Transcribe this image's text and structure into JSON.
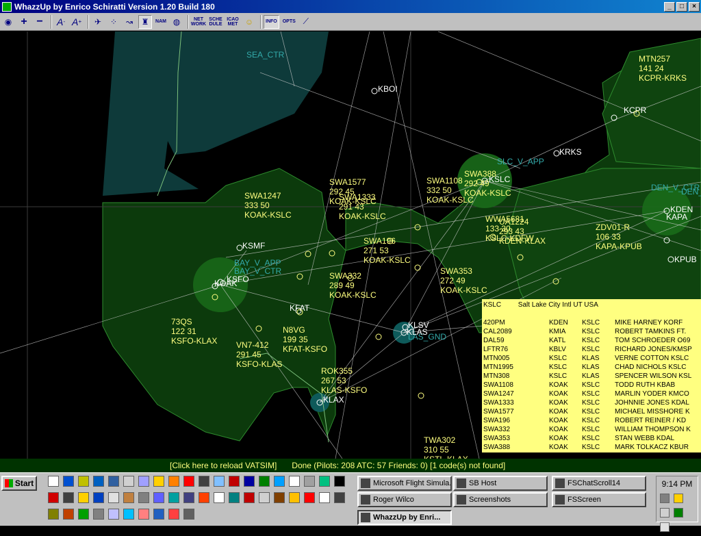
{
  "window": {
    "title": "WhazzUp by Enrico Schiratti Version 1.20 Build 180"
  },
  "toolbar": {
    "net_work": "NET WORK",
    "schedule": "SCHE DULE",
    "icao_met": "ICAO MET",
    "nam": "NAM",
    "info": "INFO",
    "opts": "OPTS"
  },
  "map": {
    "sector_labels": [
      {
        "text": "SEA_CTR"
      },
      {
        "text": "SLC_V_APP"
      },
      {
        "text": "DEN_V_CTR"
      },
      {
        "text": "DEN_"
      },
      {
        "text": "BAY_V_APP"
      },
      {
        "text": "BAY_V_CTR"
      },
      {
        "text": "LAS_GND"
      }
    ],
    "airports": [
      {
        "code": "KBOI"
      },
      {
        "code": "KCPR"
      },
      {
        "code": "KRKS"
      },
      {
        "code": "KSLC"
      },
      {
        "code": "KDEN"
      },
      {
        "code": "KAPA"
      },
      {
        "code": "KPUB"
      },
      {
        "code": "KSMF"
      },
      {
        "code": "KSFO"
      },
      {
        "code": "KOAK"
      },
      {
        "code": "KFAT"
      },
      {
        "code": "KLSV"
      },
      {
        "code": "KLAS"
      },
      {
        "code": "KLAX"
      }
    ],
    "flights": [
      {
        "callsign": "MTN257",
        "alt_spd": "141 24",
        "route": "KCPR-KRKS"
      },
      {
        "callsign": "SWA1247",
        "alt_spd": "333 50",
        "route": "KOAK-KSLC"
      },
      {
        "callsign": "SWA1577",
        "alt_spd": "292 45",
        "route": "KOAK-KSLC"
      },
      {
        "callsign": "SWA1333",
        "alt_spd": "291 43",
        "route": "KOAK-KSLC"
      },
      {
        "callsign": "SWA1108",
        "alt_spd": "332 50",
        "route": "KOAK-KSLC"
      },
      {
        "callsign": "SWA388",
        "alt_spd": "292 49",
        "route": "KOAK-KSLC"
      },
      {
        "callsign": "WWA5681",
        "alt_spd": "133 30",
        "route": "KSLC-KDFW"
      },
      {
        "callsign": "UA1224",
        "alt_spd": "293 43",
        "route": "KDEN-KLAX"
      },
      {
        "callsign": "ZDV01-R",
        "alt_spd": "106 33",
        "route": "KAPA-KPUB"
      },
      {
        "callsign": "SWA196",
        "alt_spd": "271 53",
        "route": "KOAK-KSLC"
      },
      {
        "callsign": "SWA332",
        "alt_spd": "289 49",
        "route": "KOAK-KSLC"
      },
      {
        "callsign": "SWA353",
        "alt_spd": "272 49",
        "route": "KOAK-KSLC"
      },
      {
        "callsign": "73QS",
        "alt_spd": "122 31",
        "route": "KSFO-KLAX"
      },
      {
        "callsign": "N8VG",
        "alt_spd": "199 35",
        "route": "KFAT-KSFO"
      },
      {
        "callsign": "VN7-412",
        "alt_spd": "291 45",
        "route": "KSFO-KLAS"
      },
      {
        "callsign": "ROK355",
        "alt_spd": "267 53",
        "route": "KLAS-KSFO"
      },
      {
        "callsign": "TWA302",
        "alt_spd": "310 55",
        "route": "KSTL-KLAX"
      }
    ]
  },
  "info_panel": {
    "code": "KSLC",
    "name": "Salt Lake City Intl UT USA",
    "rows": [
      {
        "callsign": "420PM",
        "from": "KDEN",
        "to": "KSLC",
        "pilot": "MIKE HARNEY KORF"
      },
      {
        "callsign": "CAL2089",
        "from": "KMIA",
        "to": "KSLC",
        "pilot": "ROBERT TAMKINS FT."
      },
      {
        "callsign": "DAL59",
        "from": "KATL",
        "to": "KSLC",
        "pilot": "TOM SCHROEDER O69"
      },
      {
        "callsign": "LFTR76",
        "from": "KBLV",
        "to": "KSLC",
        "pilot": "RICHARD JONES/KMSP"
      },
      {
        "callsign": "MTN005",
        "from": "KSLC",
        "to": "KLAS",
        "pilot": "VERNE COTTON KSLC"
      },
      {
        "callsign": "MTN1995",
        "from": "KSLC",
        "to": "KLAS",
        "pilot": "CHAD NICHOLS KSLC"
      },
      {
        "callsign": "MTN308",
        "from": "KSLC",
        "to": "KLAS",
        "pilot": "SPENCER WILSON KSL"
      },
      {
        "callsign": "SWA1108",
        "from": "KOAK",
        "to": "KSLC",
        "pilot": "TODD RUTH KBAB"
      },
      {
        "callsign": "SWA1247",
        "from": "KOAK",
        "to": "KSLC",
        "pilot": "MARLIN YODER KMCO"
      },
      {
        "callsign": "SWA1333",
        "from": "KOAK",
        "to": "KSLC",
        "pilot": "JOHNNIE JONES KDAL"
      },
      {
        "callsign": "SWA1577",
        "from": "KOAK",
        "to": "KSLC",
        "pilot": "MICHAEL MISSHORE K"
      },
      {
        "callsign": "SWA196",
        "from": "KOAK",
        "to": "KSLC",
        "pilot": "ROBERT REINER / KD"
      },
      {
        "callsign": "SWA332",
        "from": "KOAK",
        "to": "KSLC",
        "pilot": "WILLIAM THOMPSON K"
      },
      {
        "callsign": "SWA353",
        "from": "KOAK",
        "to": "KSLC",
        "pilot": "STAN WEBB KDAL"
      },
      {
        "callsign": "SWA388",
        "from": "KOAK",
        "to": "KSLC",
        "pilot": "MARK TOLKACZ KBUR"
      }
    ]
  },
  "status": {
    "reload": "[Click here to reload VATSIM]",
    "text": "Done (Pilots: 208  ATC: 57  Friends: 0) [1 code(s) not found]"
  },
  "taskbar": {
    "start": "Start",
    "tasks": [
      {
        "label": "Microsoft Flight Simula..."
      },
      {
        "label": "SB Host"
      },
      {
        "label": "FSChatScroll14"
      },
      {
        "label": "Roger Wilco"
      },
      {
        "label": "Screenshots"
      },
      {
        "label": "FSScreen"
      },
      {
        "label": "WhazzUp by Enri..."
      }
    ],
    "clock": "9:14 PM"
  },
  "colors": {
    "sector_fill": "#0c3a0c",
    "sector_border": "#2e8b2e",
    "teal_region": "#0e3a3a",
    "flight_text": "#ffff80",
    "sector_text": "#33aaaa",
    "info_bg": "#ffff80"
  }
}
